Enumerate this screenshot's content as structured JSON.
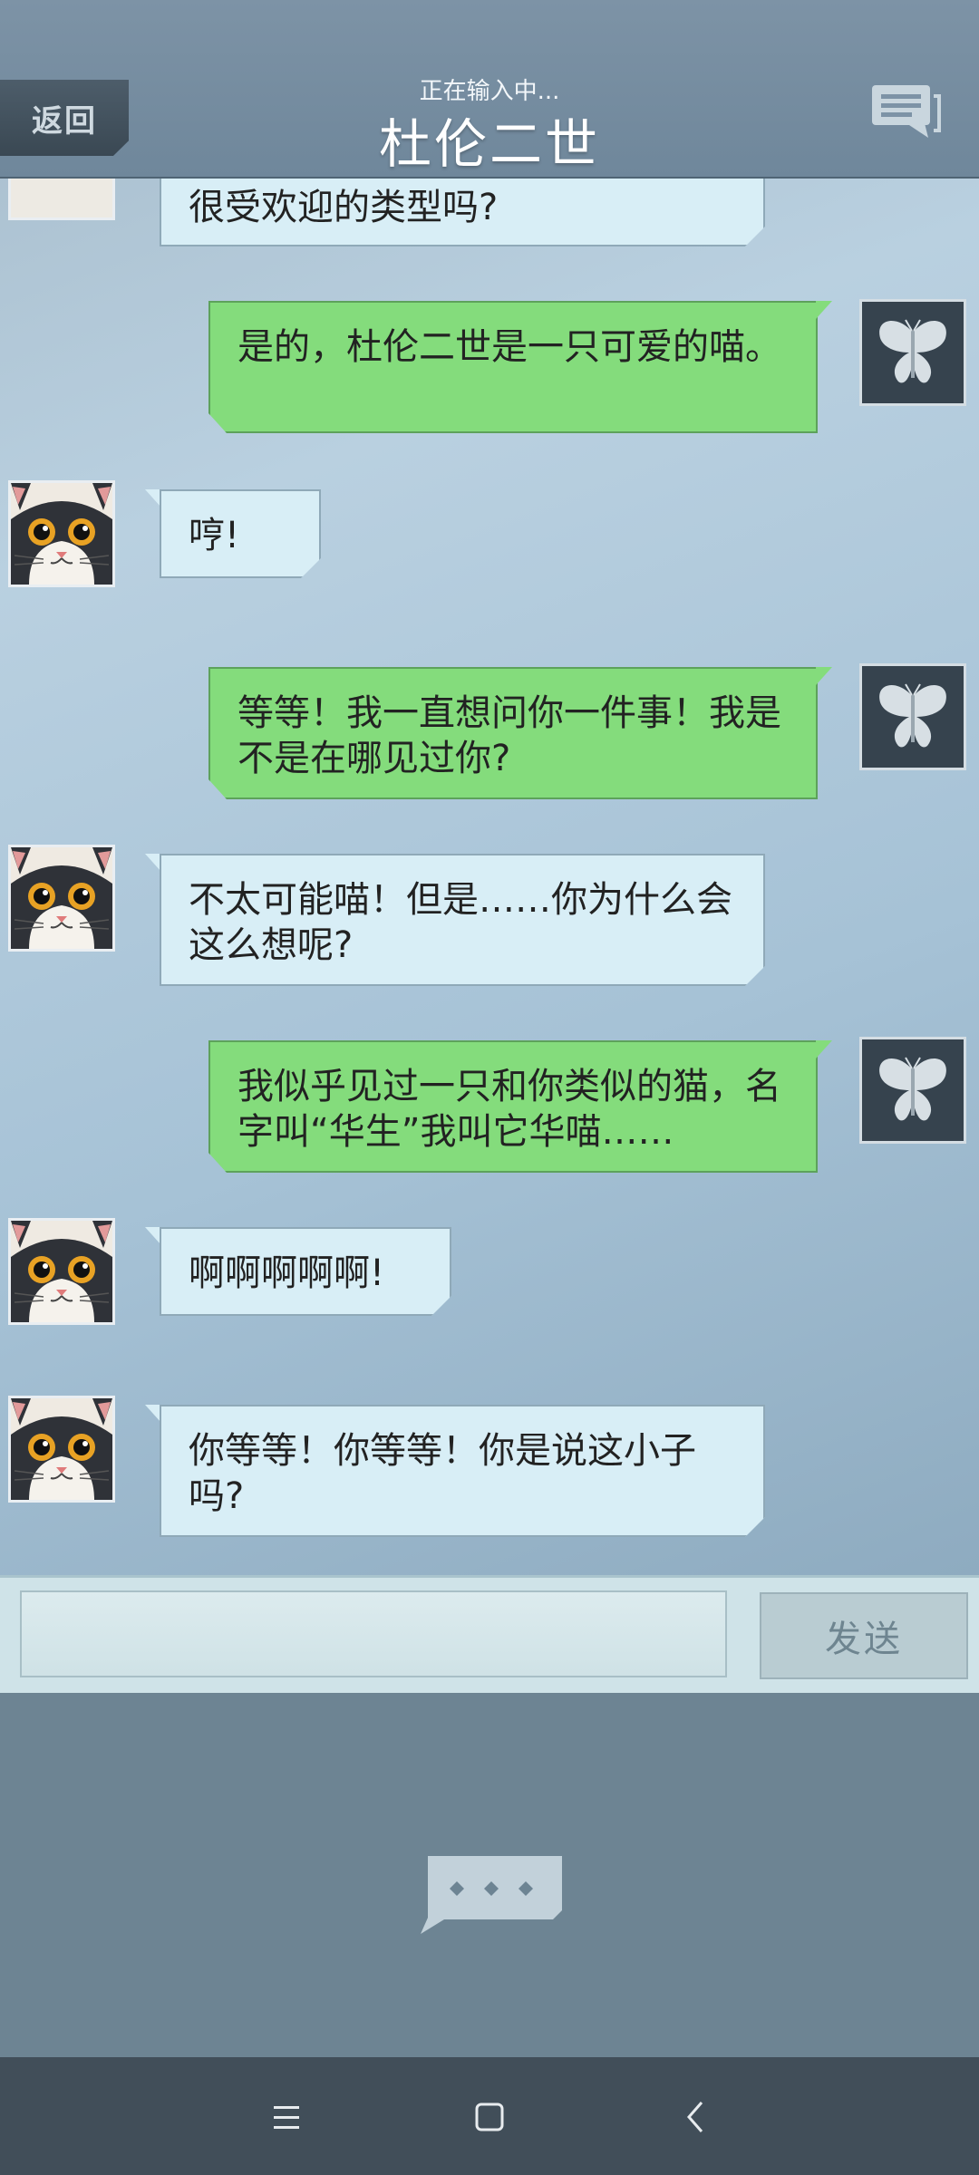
{
  "header": {
    "back_label": "返回",
    "typing_status": "正在输入中...",
    "title": "杜伦二世"
  },
  "messages": [
    {
      "side": "in",
      "sender": "cat",
      "text": "很受欢迎的类型吗?"
    },
    {
      "side": "out",
      "sender": "butterfly",
      "text": "是的，杜伦二世是一只可爱的喵。"
    },
    {
      "side": "in",
      "sender": "cat",
      "text": "哼!"
    },
    {
      "side": "out",
      "sender": "butterfly",
      "text": "等等！我一直想问你一件事！我是不是在哪见过你?"
    },
    {
      "side": "in",
      "sender": "cat",
      "text": "不太可能喵！但是……你为什么会这么想呢?"
    },
    {
      "side": "out",
      "sender": "butterfly",
      "text": "我似乎见过一只和你类似的猫，名字叫“华生”我叫它华喵……"
    },
    {
      "side": "in",
      "sender": "cat",
      "text": "啊啊啊啊啊!"
    },
    {
      "side": "in",
      "sender": "cat",
      "text": "你等等！你等等！你是说这小子吗?"
    }
  ],
  "input": {
    "placeholder": "",
    "send_label": "发送"
  },
  "icons": {
    "header_right": "chat-bubbles-icon",
    "cat_avatar": "cat-avatar",
    "butterfly_avatar": "butterfly-avatar",
    "typing_indicator": "ellipsis-bubble-icon",
    "nav": [
      "menu-icon",
      "home-icon",
      "back-icon"
    ]
  },
  "colors": {
    "outgoing_bubble": "#84dc7c",
    "incoming_bubble": "#d8eef6",
    "header": "#7d93a6",
    "navbar": "#414e59"
  }
}
